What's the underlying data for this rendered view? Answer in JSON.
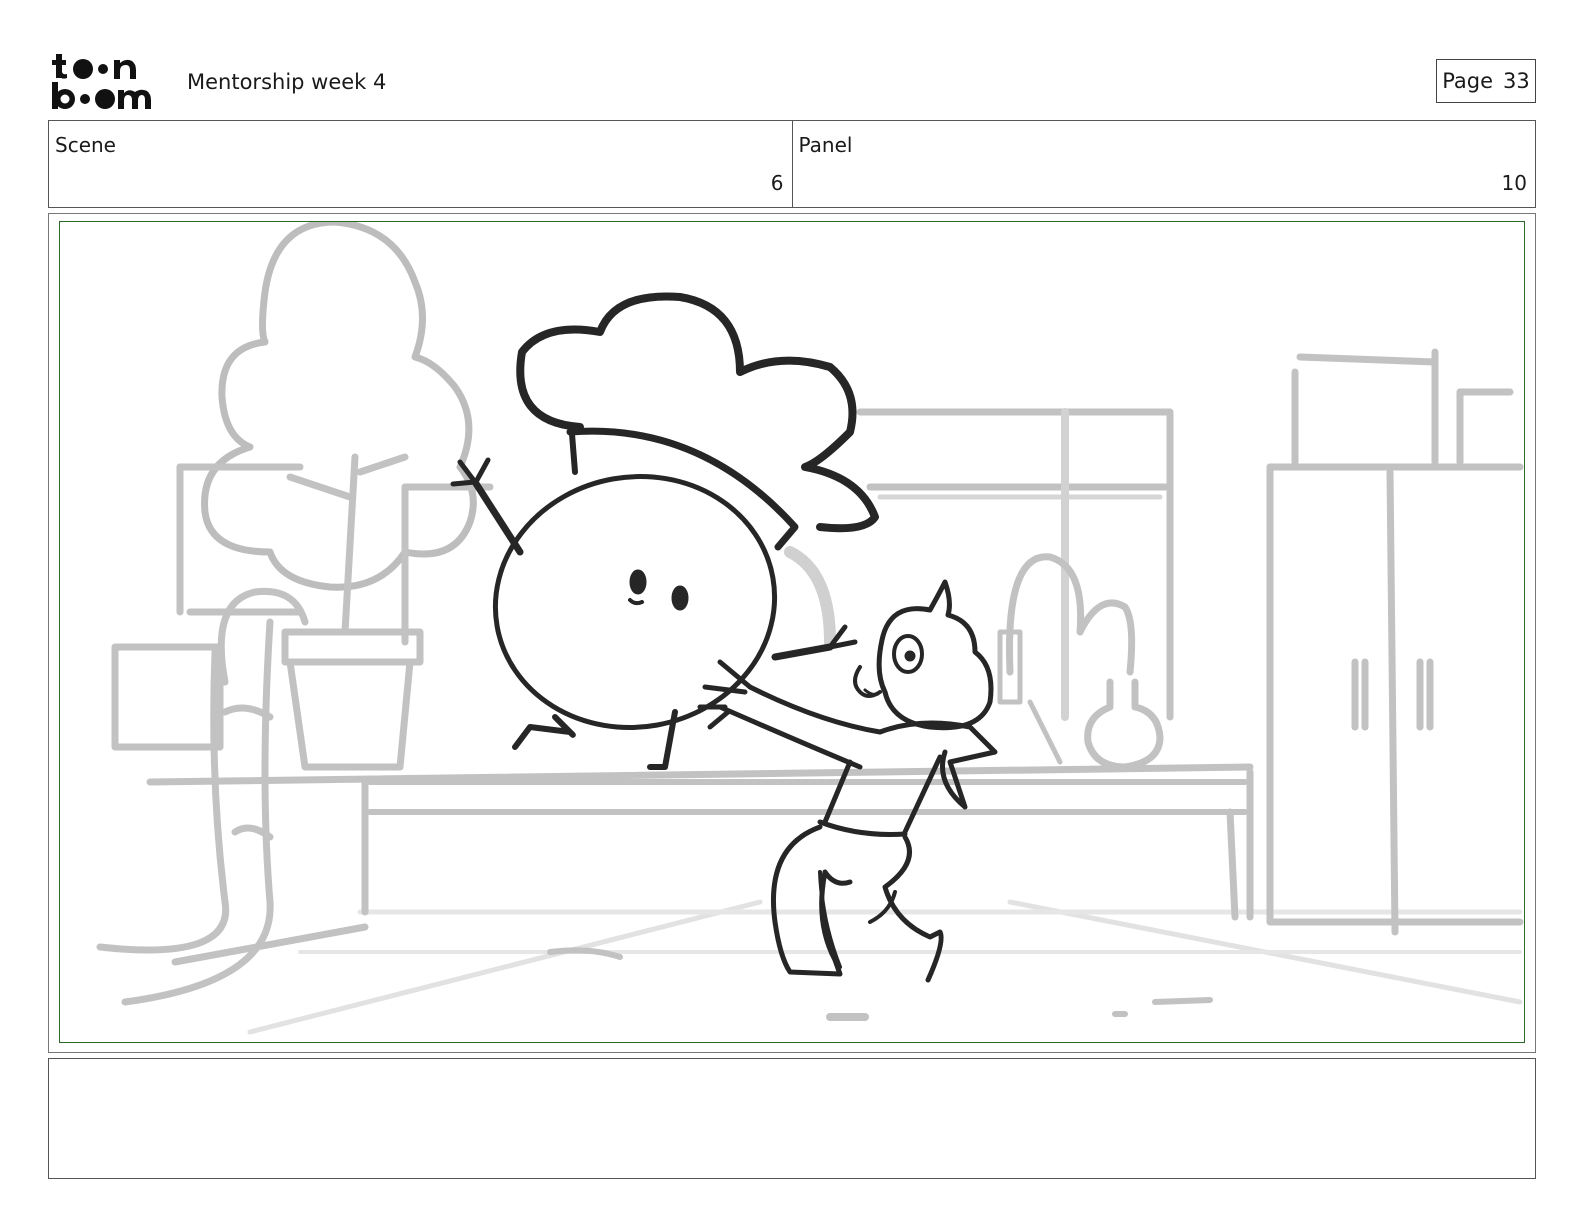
{
  "header": {
    "project_title": "Mentorship week 4",
    "page_label": "Page",
    "page_number": "33"
  },
  "logo": {
    "icon": "toon-boom-logo-icon",
    "text": "toon boom"
  },
  "scene": {
    "label": "Scene",
    "value": "6"
  },
  "panel": {
    "label": "Panel",
    "value": "10"
  },
  "notes": {
    "text": ""
  },
  "colors": {
    "frame_border": "#2e6b2a",
    "background_lines": "#b8b8b8",
    "character_lines": "#2a2a2a"
  }
}
